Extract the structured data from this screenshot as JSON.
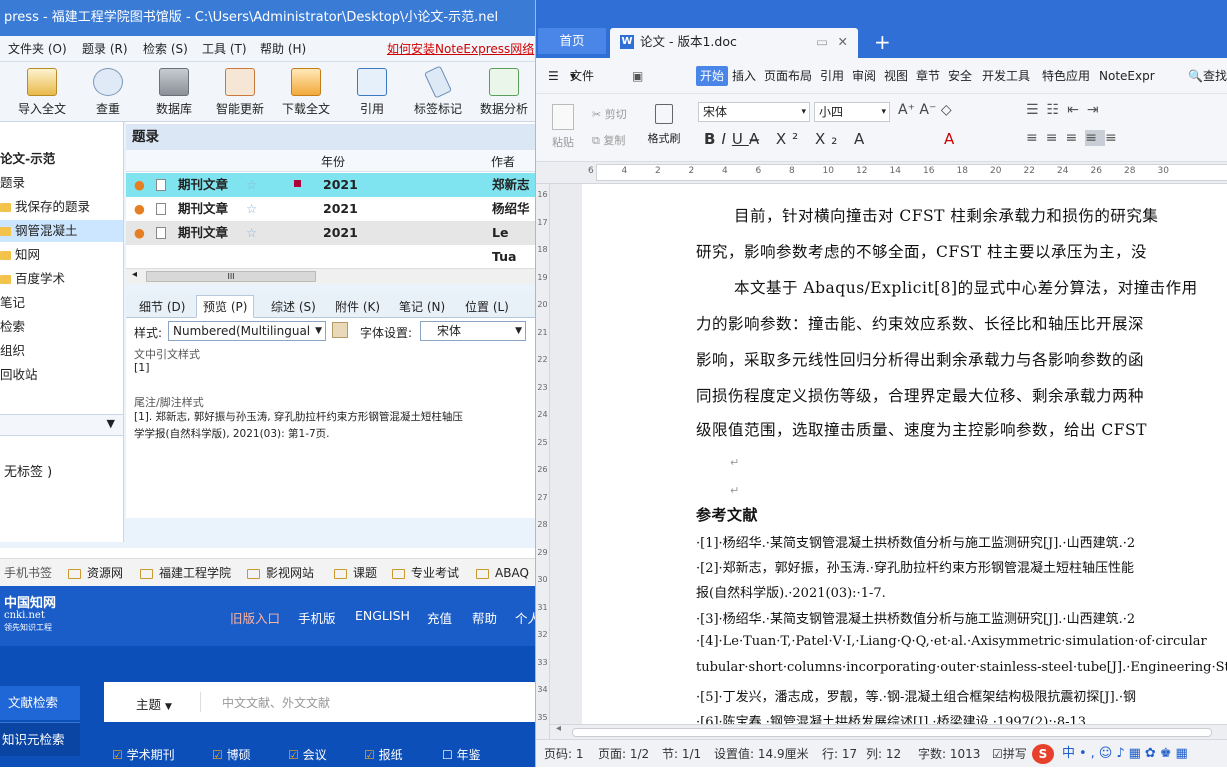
{
  "noteexpress": {
    "title": "press - 福建工程学院图书馆版 - C:\\Users\\Administrator\\Desktop\\小论文-示范.nel",
    "menu": [
      "文件夹 (O)",
      "题录 (R)",
      "检索 (S)",
      "工具 (T)",
      "帮助 (H)"
    ],
    "promo": "如何安装NoteExpress网络",
    "toolbar": [
      "导入全文",
      "查重",
      "数据库",
      "智能更新",
      "下载全文",
      "引用",
      "标签标记",
      "数据分析"
    ],
    "tree": {
      "root": "论文-示范",
      "items": [
        "题录",
        "我保存的题录",
        "钢管混凝土",
        "知网",
        "百度学术",
        "笔记",
        "检索",
        "组织",
        "回收站"
      ],
      "tags_label": "无标签 )"
    },
    "list": {
      "header": "题录",
      "col_year": "年份",
      "col_author": "作者",
      "rows": [
        {
          "type": "期刊文章",
          "year": "2021",
          "author": "郑新志"
        },
        {
          "type": "期刊文章",
          "year": "2021",
          "author": "杨绍华"
        },
        {
          "type": "期刊文章",
          "year": "2021",
          "author": "Le Tua"
        }
      ],
      "scroll_glyph": "III"
    },
    "tabs": [
      "细节 (D)",
      "预览 (P)",
      "综述 (S)",
      "附件 (K)",
      "笔记 (N)",
      "位置 (L)"
    ],
    "preview": {
      "style_label": "样式:",
      "style_value": "Numbered(Multilingual",
      "font_label": "字体设置:",
      "font_value": "宋体",
      "cite_heading": "文中引文样式",
      "cite_value": "[1]",
      "footnote_heading": "尾注/脚注样式",
      "ref_line1": "[1].    郑新志, 郭好振与孙玉涛, 穿孔肋拉杆约束方形钢管混凝土短柱轴压",
      "ref_line2": "学学报(自然科学版), 2021(03): 第1-7页."
    }
  },
  "bookmarks": [
    "手机书签",
    "资源网",
    "福建工程学院",
    "影视网站",
    "课题",
    "专业考试",
    "ABAQ"
  ],
  "cnki": {
    "logo_line1": "中国知网",
    "logo_line2": "cnki.net",
    "logo_line3": "领先知识工程",
    "nav": [
      "旧版入口",
      "手机版",
      "ENGLISH",
      "充值",
      "帮助",
      "个人"
    ],
    "side": [
      "文献检索",
      "知识元检索"
    ],
    "search_field": "主题",
    "search_placeholder": "中文文献、外文文献",
    "checks": [
      "学术期刊",
      "博硕",
      "会议",
      "报纸",
      "年鉴"
    ]
  },
  "wps": {
    "tab_home": "首页",
    "tab_doc": "论文 - 版本1.doc",
    "new_tab": "+",
    "menu_file": "文件",
    "menu": [
      "开始",
      "插入",
      "页面布局",
      "引用",
      "审阅",
      "视图",
      "章节",
      "安全",
      "开发工具",
      "特色应用",
      "NoteExpr"
    ],
    "search": "查找",
    "ribbon": {
      "paste": "粘贴",
      "cut": "剪切",
      "copy": "复制",
      "format_painter": "格式刷",
      "font": "宋体",
      "size": "小四"
    },
    "ruler_numbers": [
      "6",
      "4",
      "2",
      "2",
      "4",
      "6",
      "8",
      "10",
      "12",
      "14",
      "16",
      "18",
      "20",
      "22",
      "24",
      "26",
      "28",
      "30"
    ],
    "vruler_numbers": [
      "16",
      "17",
      "18",
      "19",
      "20",
      "21",
      "22",
      "23",
      "24",
      "25",
      "26",
      "27",
      "28",
      "29",
      "30",
      "31",
      "32",
      "33",
      "34",
      "35"
    ],
    "doc": {
      "p1": "目前，针对横向撞击对 CFST 柱剩余承载力和损伤的研究集",
      "p2": "研究，影响参数考虑的不够全面，CFST 柱主要以承压为主，没",
      "p3": "本文基于 Abaqus/Explicit[8]的显式中心差分算法，对撞击作用",
      "p4": "力的影响参数：撞击能、约束效应系数、长径比和轴压比开展深",
      "p5": "影响，采取多元线性回归分析得出剩余承载力与各影响参数的函",
      "p6": "同损伤程度定义损伤等级，合理界定最大位移、剩余承载力两种",
      "p7": "级限值范围，选取撞击质量、速度为主控影响参数，给出 CFST",
      "ref_title": "参考文献",
      "refs": [
        "·[1]·杨绍华.·某简支钢管混凝土拱桥数值分析与施工监测研究[J].·山西建筑.·2",
        "·[2]·郑新志，郭好振，孙玉涛.·穿孔肋拉杆约束方形钢管混凝土短柱轴压性能",
        "报(自然科学版).·2021(03):·1-7.",
        "·[3]·杨绍华.·某简支钢管混凝土拱桥数值分析与施工监测研究[J].·山西建筑.·2",
        "·[4]·Le·Tuan·T,·Patel·V·I,·Liang·Q·Q,·et·al.·Axisymmetric·simulation·of·circular",
        "tubular·short·columns·incorporating·outer·stainless-steel·tube[J].·Engineering·Struc",
        "·[5]·丁发兴，潘志成，罗靓，等.·钢-混凝土组合框架结构极限抗震初探[J].·钢",
        "·[6]·陈宝春.·钢管混凝土拱桥发展综述[J].·桥梁建设.·1997(2):·8-13."
      ]
    },
    "status": [
      "页码: 1",
      "页面: 1/2",
      "节: 1/1",
      "设置值: 14.9厘米",
      "行: 17",
      "列: 12",
      "字数: 1013",
      "拼写"
    ]
  },
  "colors": {
    "ne_blue": "#3a7bd5",
    "wps_blue": "#2f6fd6",
    "cnki_blue": "#0d4fb8",
    "selected_row": "#7fe4ef",
    "promo_red": "#d00000"
  }
}
